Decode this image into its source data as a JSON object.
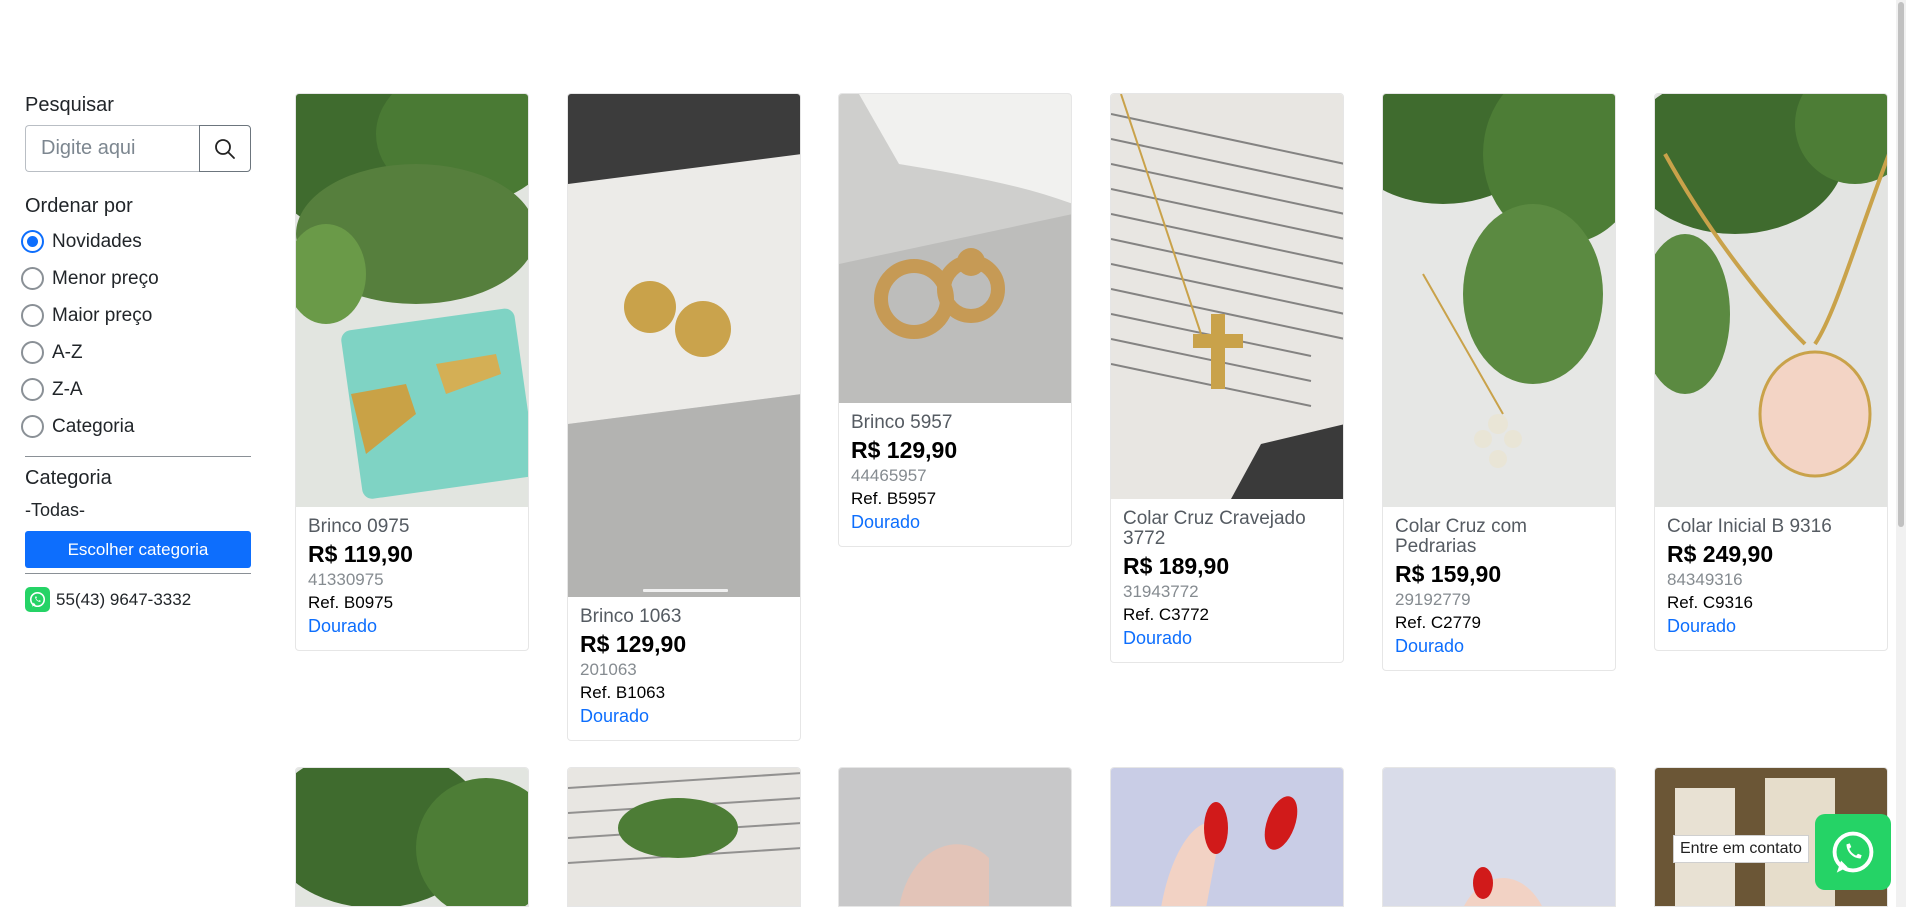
{
  "search": {
    "label": "Pesquisar",
    "placeholder": "Digite aqui"
  },
  "order": {
    "label": "Ordenar por",
    "options": [
      "Novidades",
      "Menor preço",
      "Maior preço",
      "A-Z",
      "Z-A",
      "Categoria"
    ],
    "selected": "Novidades"
  },
  "category": {
    "label": "Categoria",
    "current": "-Todas-",
    "button_label": "Escolher categoria"
  },
  "contact": {
    "phone": "55(43) 9647-3332"
  },
  "products": [
    {
      "name": "Brinco 0975",
      "price": "R$ 119,90",
      "code": "41330975",
      "ref": "Ref. B0975",
      "color": "Dourado"
    },
    {
      "name": "Brinco 1063",
      "price": "R$ 129,90",
      "code": "201063",
      "ref": "Ref. B1063",
      "color": "Dourado"
    },
    {
      "name": "Brinco 5957",
      "price": "R$ 129,90",
      "code": "44465957",
      "ref": "Ref. B5957",
      "color": "Dourado"
    },
    {
      "name": "Colar Cruz Cravejado 3772",
      "price": "R$ 189,90",
      "code": "31943772",
      "ref": "Ref. C3772",
      "color": "Dourado"
    },
    {
      "name": "Colar Cruz com Pedrarias",
      "price": "R$ 159,90",
      "code": "29192779",
      "ref": "Ref. C2779",
      "color": "Dourado"
    },
    {
      "name": "Colar Inicial B 9316",
      "price": "R$ 249,90",
      "code": "84349316",
      "ref": "Ref. C9316",
      "color": "Dourado"
    }
  ],
  "contact_tooltip": "Entre em contato",
  "colors": {
    "primary": "#0d6efd",
    "whatsapp": "#25d366"
  }
}
